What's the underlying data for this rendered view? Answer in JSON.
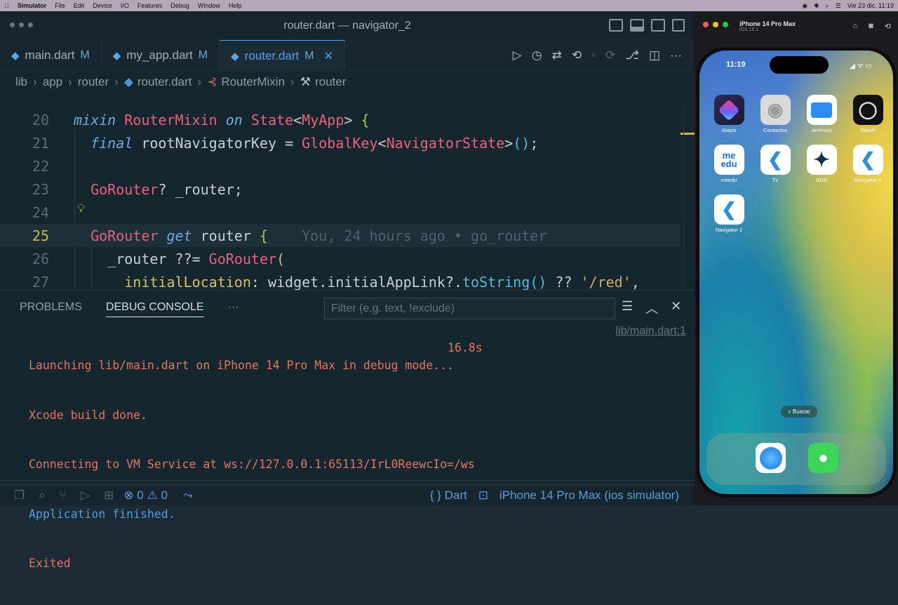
{
  "menubar": {
    "app": "Simulator",
    "items": [
      "File",
      "Edit",
      "Device",
      "I/O",
      "Features",
      "Debug",
      "Window",
      "Help"
    ],
    "datetime": "Vie 23 dic.  11:19"
  },
  "window": {
    "title": "router.dart — navigator_2"
  },
  "tabs": [
    {
      "label": "main.dart",
      "status": "M"
    },
    {
      "label": "my_app.dart",
      "status": "M"
    },
    {
      "label": "router.dart",
      "status": "M"
    }
  ],
  "breadcrumb": [
    "lib",
    "app",
    "router",
    "router.dart",
    "RouterMixin",
    "router"
  ],
  "editor": {
    "line_numbers": [
      "20",
      "21",
      "22",
      "23",
      "24",
      "25",
      "26",
      "27"
    ],
    "current_line": "25",
    "blame": "You, 24 hours ago • go_router"
  },
  "panel": {
    "tabs": [
      "PROBLEMS",
      "DEBUG CONSOLE",
      "···"
    ],
    "filter_placeholder": "Filter (e.g. text, !exclude)",
    "console_lines": [
      "Launching lib/main.dart on iPhone 14 Pro Max in debug mode...",
      "Xcode build done.",
      "Connecting to VM Service at ws://127.0.0.1:65113/IrL0ReewcIo=/ws",
      "Application finished.",
      "Exited"
    ],
    "build_time": "16.8s",
    "source_link": "lib/main.dart:1",
    "prompt": ">"
  },
  "statusbar": {
    "errors": "0",
    "warnings": "0",
    "language": "{ } Dart",
    "device": "iPhone 14 Pro Max (ios simulator)"
  },
  "simulator": {
    "device_name": "iPhone 14 Pro Max",
    "os_version": "iOS 16.1",
    "time": "11:19",
    "apps": [
      {
        "label": "Atajos",
        "icon": "shortcuts-icon"
      },
      {
        "label": "Contactos",
        "icon": "contacts-icon"
      },
      {
        "label": "Archivos",
        "icon": "files-icon"
      },
      {
        "label": "Watch",
        "icon": "watch-icon"
      },
      {
        "label": "meedu",
        "icon": "meedu-icon",
        "icon_text": "me\nedu"
      },
      {
        "label": "Tv",
        "icon": "flutter-icon"
      },
      {
        "label": "ADS",
        "icon": "compass-star-icon"
      },
      {
        "label": "Navigator 2",
        "icon": "flutter-icon"
      },
      {
        "label": "Navigator 2",
        "icon": "flutter-icon"
      }
    ],
    "search_label": "Buscar",
    "dock": [
      {
        "icon": "safari-icon"
      },
      {
        "icon": "messages-icon"
      }
    ]
  },
  "colors": {
    "accent": "#4fa3f0",
    "error_text": "#e47562",
    "info_text": "#4d9fe6",
    "current_line_number": "#d8b24a"
  }
}
